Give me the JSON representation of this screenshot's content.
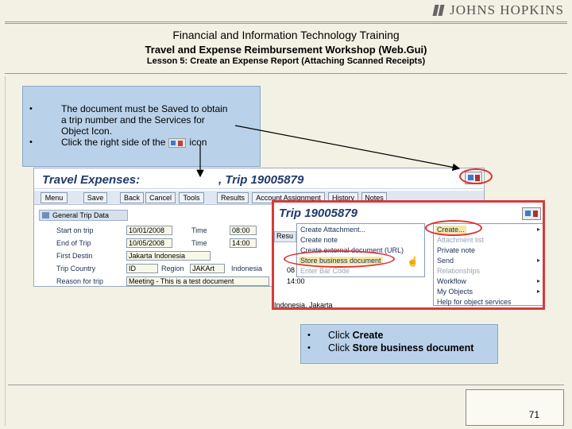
{
  "header": {
    "brand": "JOHNS HOPKINS",
    "title": "Financial and Information Technology Training",
    "subtitle": "Travel and Expense Reimbursement Workshop (Web.Gui)",
    "lesson": "Lesson 5: Create an Expense Report (Attaching Scanned Receipts)"
  },
  "instructions": {
    "bullet": "•",
    "line1": "The document must be Saved to obtain",
    "line2": "a trip number and the Services for",
    "line3": "Object Icon.",
    "line4_pre": "Click the right side of the",
    "line4_post": "icon"
  },
  "sap": {
    "title": "Travel Expenses:",
    "trip": ", Trip 19005879",
    "toolbar": [
      "Menu",
      "Save",
      "Back",
      "Cancel",
      "Tools",
      "Results",
      "Account Assignment",
      "History",
      "Notes"
    ],
    "section": "General Trip Data",
    "rows": [
      {
        "label": "Start on trip",
        "date": "10/01/2008",
        "time_label": "Time",
        "time": "08:00"
      },
      {
        "label": "End of Trip",
        "date": "10/05/2008",
        "time_label": "Time",
        "time": "14:00"
      }
    ],
    "first_dest_label": "First Destin",
    "first_dest": "Jakarta Indonesia",
    "country_label": "Trip Country",
    "country": "ID",
    "region_label": "Region",
    "region": "JAKArt",
    "country_name": "Indonesia",
    "reason_label": "Reason for trip",
    "reason": "Meeting - This is a test document"
  },
  "zoom": {
    "trip": "Trip 19005879",
    "resu": "Resu",
    "val08": "08",
    "val1400": "14:00",
    "address": "Indonesia, Jakarta",
    "menu_left": [
      {
        "label": "Create Attachment...",
        "state": "normal"
      },
      {
        "label": "Create note",
        "state": "normal"
      },
      {
        "label": "Create external document (URL)",
        "state": "normal"
      },
      {
        "label": "Store business document",
        "state": "highlight"
      },
      {
        "label": "Enter Bar Code",
        "state": "disabled"
      }
    ],
    "menu_right": [
      {
        "label": "Create...",
        "state": "highlight",
        "submenu": true
      },
      {
        "label": "Attachment list",
        "state": "disabled",
        "submenu": false
      },
      {
        "label": "Private note",
        "state": "normal",
        "submenu": false
      },
      {
        "label": "Send",
        "state": "normal",
        "submenu": true
      },
      {
        "label": "Relationships",
        "state": "disabled",
        "submenu": false
      },
      {
        "label": "Workflow",
        "state": "normal",
        "submenu": true
      },
      {
        "label": "My Objects",
        "state": "normal",
        "submenu": true
      },
      {
        "label": "Help for object services",
        "state": "normal",
        "submenu": false
      }
    ]
  },
  "instructions2": {
    "bullet": "•",
    "line1_pre": "Click ",
    "line1_bold": "Create",
    "line2_pre": "Click ",
    "line2_bold": "Store business document"
  },
  "footer": {
    "page": "71"
  }
}
